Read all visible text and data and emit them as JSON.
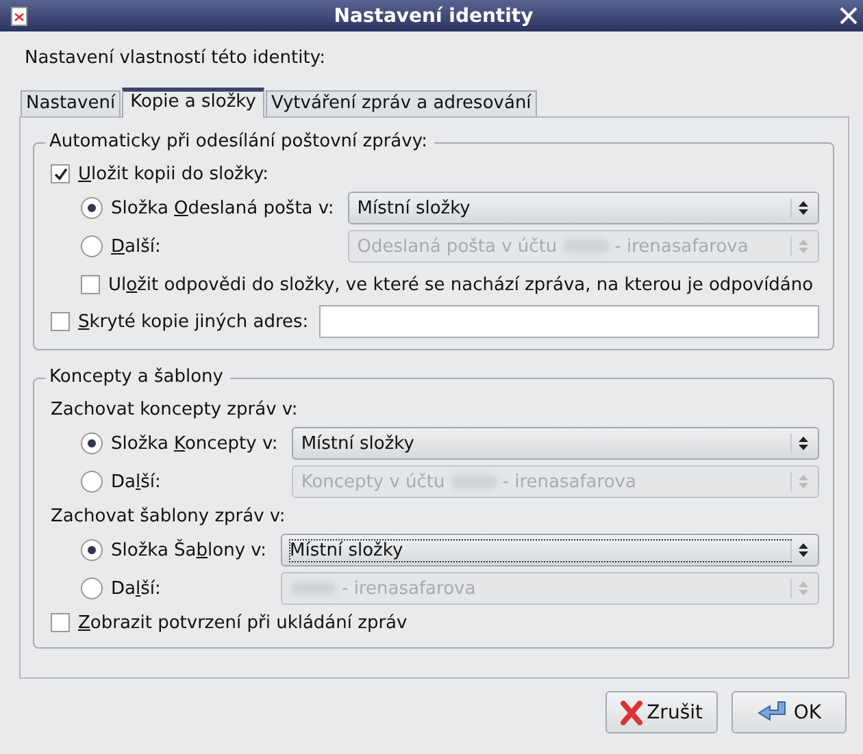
{
  "window": {
    "title": "Nastavení identity"
  },
  "heading": "Nastavení vlastností této identity:",
  "tabs": [
    {
      "label": "Nastavení",
      "selected": false
    },
    {
      "label": "Kopie a složky",
      "selected": true
    },
    {
      "label": "Vytváření zpráv a adresování",
      "selected": false
    }
  ],
  "groups": [
    {
      "title": "Automaticky při odesílání poštovní zprávy:",
      "rows": [
        {
          "kind": "checkbox",
          "checked": true,
          "label": {
            "key": "U",
            "post": "ložit kopii do složky:"
          },
          "children": [
            {
              "kind": "radio",
              "selected": true,
              "label": {
                "pre": "Složka ",
                "key": "O",
                "post": "deslaná pošta v:"
              },
              "select": {
                "disabled": false,
                "focused": false,
                "segments": [
                  {
                    "kind": "text",
                    "text": "Místní složky"
                  }
                ]
              }
            },
            {
              "kind": "radio",
              "selected": false,
              "label": {
                "key": "D",
                "post": "alší:"
              },
              "select": {
                "disabled": true,
                "focused": false,
                "segments": [
                  {
                    "kind": "text",
                    "text": "Odeslaná pošta v účtu"
                  },
                  {
                    "kind": "redacted"
                  },
                  {
                    "kind": "text",
                    "text": "- irenasafarova"
                  }
                ]
              }
            },
            {
              "kind": "checkbox",
              "checked": false,
              "label": {
                "pre": "Ul",
                "key": "o",
                "post": "žit odpovědi do složky, ve které se nachází zpráva, na kterou je odpovídáno"
              }
            }
          ]
        },
        {
          "kind": "checkbox-field",
          "checked": false,
          "label": {
            "key": "S",
            "post": "kryté kopie jiných adres:"
          }
        }
      ]
    },
    {
      "title": "Koncepty a šablony",
      "rows": [
        {
          "kind": "label",
          "text": "Zachovat koncepty zpráv v:",
          "children": [
            {
              "kind": "radio",
              "selected": true,
              "label": {
                "pre": "Složka ",
                "key": "K",
                "post": "oncepty v:"
              },
              "select": {
                "disabled": false,
                "focused": false,
                "segments": [
                  {
                    "kind": "text",
                    "text": "Místní složky"
                  }
                ]
              }
            },
            {
              "kind": "radio",
              "selected": false,
              "label": {
                "pre": "Da",
                "key": "l",
                "post": "ší:"
              },
              "select": {
                "disabled": true,
                "focused": false,
                "segments": [
                  {
                    "kind": "text",
                    "text": "Koncepty v účtu"
                  },
                  {
                    "kind": "redacted"
                  },
                  {
                    "kind": "text",
                    "text": "- irenasafarova"
                  }
                ]
              }
            }
          ]
        },
        {
          "kind": "label",
          "text": "Zachovat šablony zpráv v:",
          "children": [
            {
              "kind": "radio",
              "selected": true,
              "label": {
                "pre": "Složka Ša",
                "key": "b",
                "post": "lony v:"
              },
              "select": {
                "disabled": false,
                "focused": true,
                "segments": [
                  {
                    "kind": "text",
                    "text": "Místní složky"
                  }
                ]
              }
            },
            {
              "kind": "radio",
              "selected": false,
              "label": {
                "pre": "Da",
                "key": "l",
                "post": "ší:"
              },
              "select": {
                "disabled": true,
                "focused": false,
                "segments": [
                  {
                    "kind": "redacted"
                  },
                  {
                    "kind": "text",
                    "text": "- irenasafarova"
                  }
                ]
              }
            }
          ]
        },
        {
          "kind": "checkbox",
          "checked": false,
          "label": {
            "key": "Z",
            "post": "obrazit potvrzení při ukládání zpráv"
          }
        }
      ]
    }
  ],
  "buttons": [
    {
      "kind": "cancel",
      "label": "Zrušit"
    },
    {
      "kind": "ok",
      "label": "OK"
    }
  ]
}
